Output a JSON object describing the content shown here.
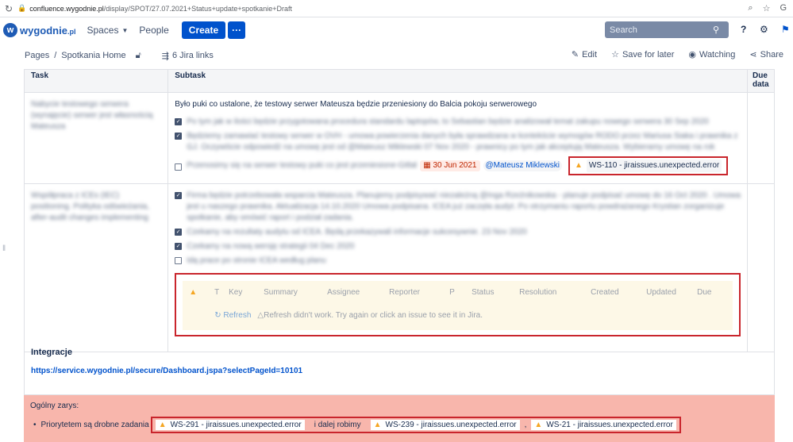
{
  "browser": {
    "url_host": "confluence.wygodnie.pl",
    "url_path": "/display/SPOT/27.07.2021+Status+update+spotkanie+Draft"
  },
  "header": {
    "logo_text": "wygodnie",
    "logo_suffix": ".pl",
    "spaces": "Spaces",
    "people": "People",
    "create": "Create",
    "more": "···",
    "search_placeholder": "Search"
  },
  "pagebar": {
    "breadcrumb_pages": "Pages",
    "breadcrumb_sep": "/",
    "breadcrumb_space": "Spotkania Home",
    "jira_links": "6 Jira links",
    "edit": "Edit",
    "save_later": "Save for later",
    "watching": "Watching",
    "share": "Share"
  },
  "table": {
    "headers": [
      "Task",
      "Subtask",
      "Due data"
    ],
    "row1": {
      "task_text": "Nabycie testowego serwera (wynajęcie) serwer jest własnością Mateusza",
      "subtask_title": "Było puki co ustalone, że testowy serwer Mateusza będzie przeniesiony do Balcia pokoju serwerowego",
      "items": [
        {
          "checked": true,
          "text": "Po tym jak w ilości będzie przygotowana procedura standardu laptopów, to Sebastian będzie analizował temat zakupu nowego serwera  30 Sep 2020"
        },
        {
          "checked": true,
          "text": "Będziemy zamawiać testowy serwer w OVH - umowa powierzenia danych była sprawdzana w kontekście wymogów RODO przez Mariusa Siaka i prawnika z GJ. Oczywiście odpowiedź na umowę jest od @Mateusz Miklewski  07 Nov 2020 - prawnicy po tym jak akceptują Mateusza. Wybieramy umowę na rok"
        },
        {
          "checked": false,
          "text": "Przenosimy się na serwer testowy puki co jest przeniesione-Gitlab",
          "date": "30 Jun 2021",
          "mention": "@Mateusz Miklewski",
          "error": "WS-110 - jiraissues.unexpected.error"
        }
      ]
    },
    "row2": {
      "task_text": "Współpraca z ICEs (IEC) positioning. Polityka odświeżania, after-audit changes implementing",
      "items": [
        {
          "checked": true,
          "text": "Firma będzie potrzebowała wsparcia Mateusza. Planujemy podpisywać niezależną  @Inga Rzeźnikowska - planuje podpisać umowę do  16 Oct 2020 . Umowa jest u naszego prawnika. Aktualizacja 14.10.2020 Umowa podpisana. ICEA już zaczęła audyt. Po otrzymaniu raportu powdrażanego Krystian zorganizuje spotkanie, aby omówić raport i podział zadania."
        },
        {
          "checked": true,
          "text": "Czekamy na rezultaty audytu od ICEA. Będą przekazywali informacje sukcesywnie.  23 Nov 2020"
        },
        {
          "checked": true,
          "text": "Czekamy na nową wersję strategii  04 Dec 2020"
        },
        {
          "checked": false,
          "text": "Idą prace po stronie ICEA według planu"
        }
      ],
      "jira_table": {
        "columns": [
          "T",
          "Key",
          "Summary",
          "Assignee",
          "Reporter",
          "P",
          "Status",
          "Resolution",
          "Created",
          "Updated",
          "Due"
        ],
        "refresh": "Refresh",
        "error_msg": "Refresh didn't work. Try again or click an issue to see it in Jira."
      }
    }
  },
  "integracje": {
    "title": "Integracje",
    "link": "https://service.wygodnie.pl/secure/Dashboard.jspa?selectPageId=10101"
  },
  "ogolny": {
    "title": "Ogólny zarys:",
    "bullet_text": "Priorytetem są drobne zadania",
    "error1": "WS-291 - jiraissues.unexpected.error",
    "middle_text": "i dalej robimy",
    "error2": "WS-239 - jiraissues.unexpected.error",
    "comma": ",",
    "error3": "WS-21 - jiraissues.unexpected.error"
  },
  "colors": {
    "primary": "#0052cc",
    "error_border": "#c9252c",
    "panel_red": "#f8b6ac",
    "warning": "#f5a623"
  }
}
